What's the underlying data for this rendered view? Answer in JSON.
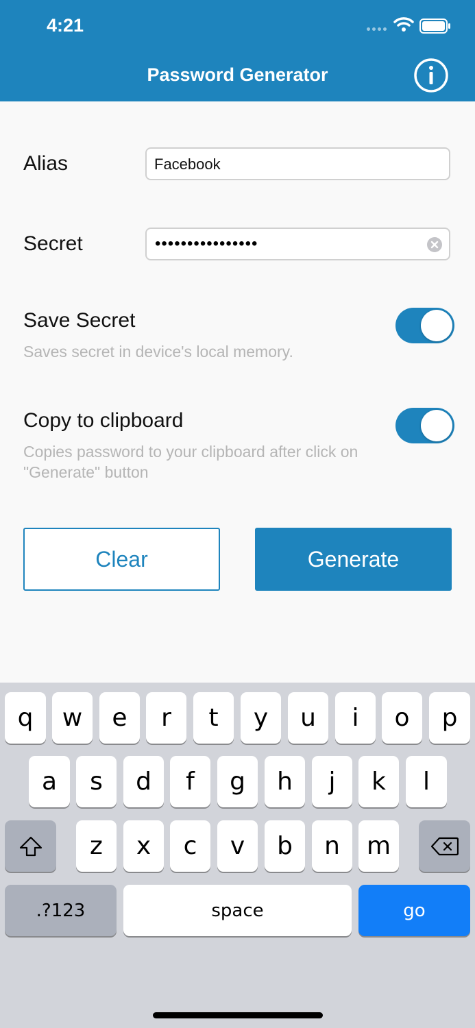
{
  "status_bar": {
    "time": "4:21"
  },
  "nav": {
    "title": "Password Generator",
    "info_icon": "info-circle-icon"
  },
  "form": {
    "alias_label": "Alias",
    "alias_value": "Facebook",
    "secret_label": "Secret",
    "secret_masked": "••••••••••••••••",
    "save_secret": {
      "title": "Save Secret",
      "description": "Saves secret in device's local memory.",
      "on": true
    },
    "copy_clipboard": {
      "title": "Copy to clipboard",
      "description_line1": "Copies password to your clipboard after click on",
      "description_line2": "\"Generate\" button",
      "on": true
    },
    "clear_label": "Clear",
    "generate_label": "Generate"
  },
  "keyboard": {
    "row1": [
      "q",
      "w",
      "e",
      "r",
      "t",
      "y",
      "u",
      "i",
      "o",
      "p"
    ],
    "row2": [
      "a",
      "s",
      "d",
      "f",
      "g",
      "h",
      "j",
      "k",
      "l"
    ],
    "row3": [
      "z",
      "x",
      "c",
      "v",
      "b",
      "n",
      "m"
    ],
    "numbers_label": ".?123",
    "space_label": "space",
    "go_label": "go"
  },
  "colors": {
    "accent": "#1e84bd",
    "go_key": "#127ef8",
    "keyboard_bg": "#d2d4da"
  }
}
